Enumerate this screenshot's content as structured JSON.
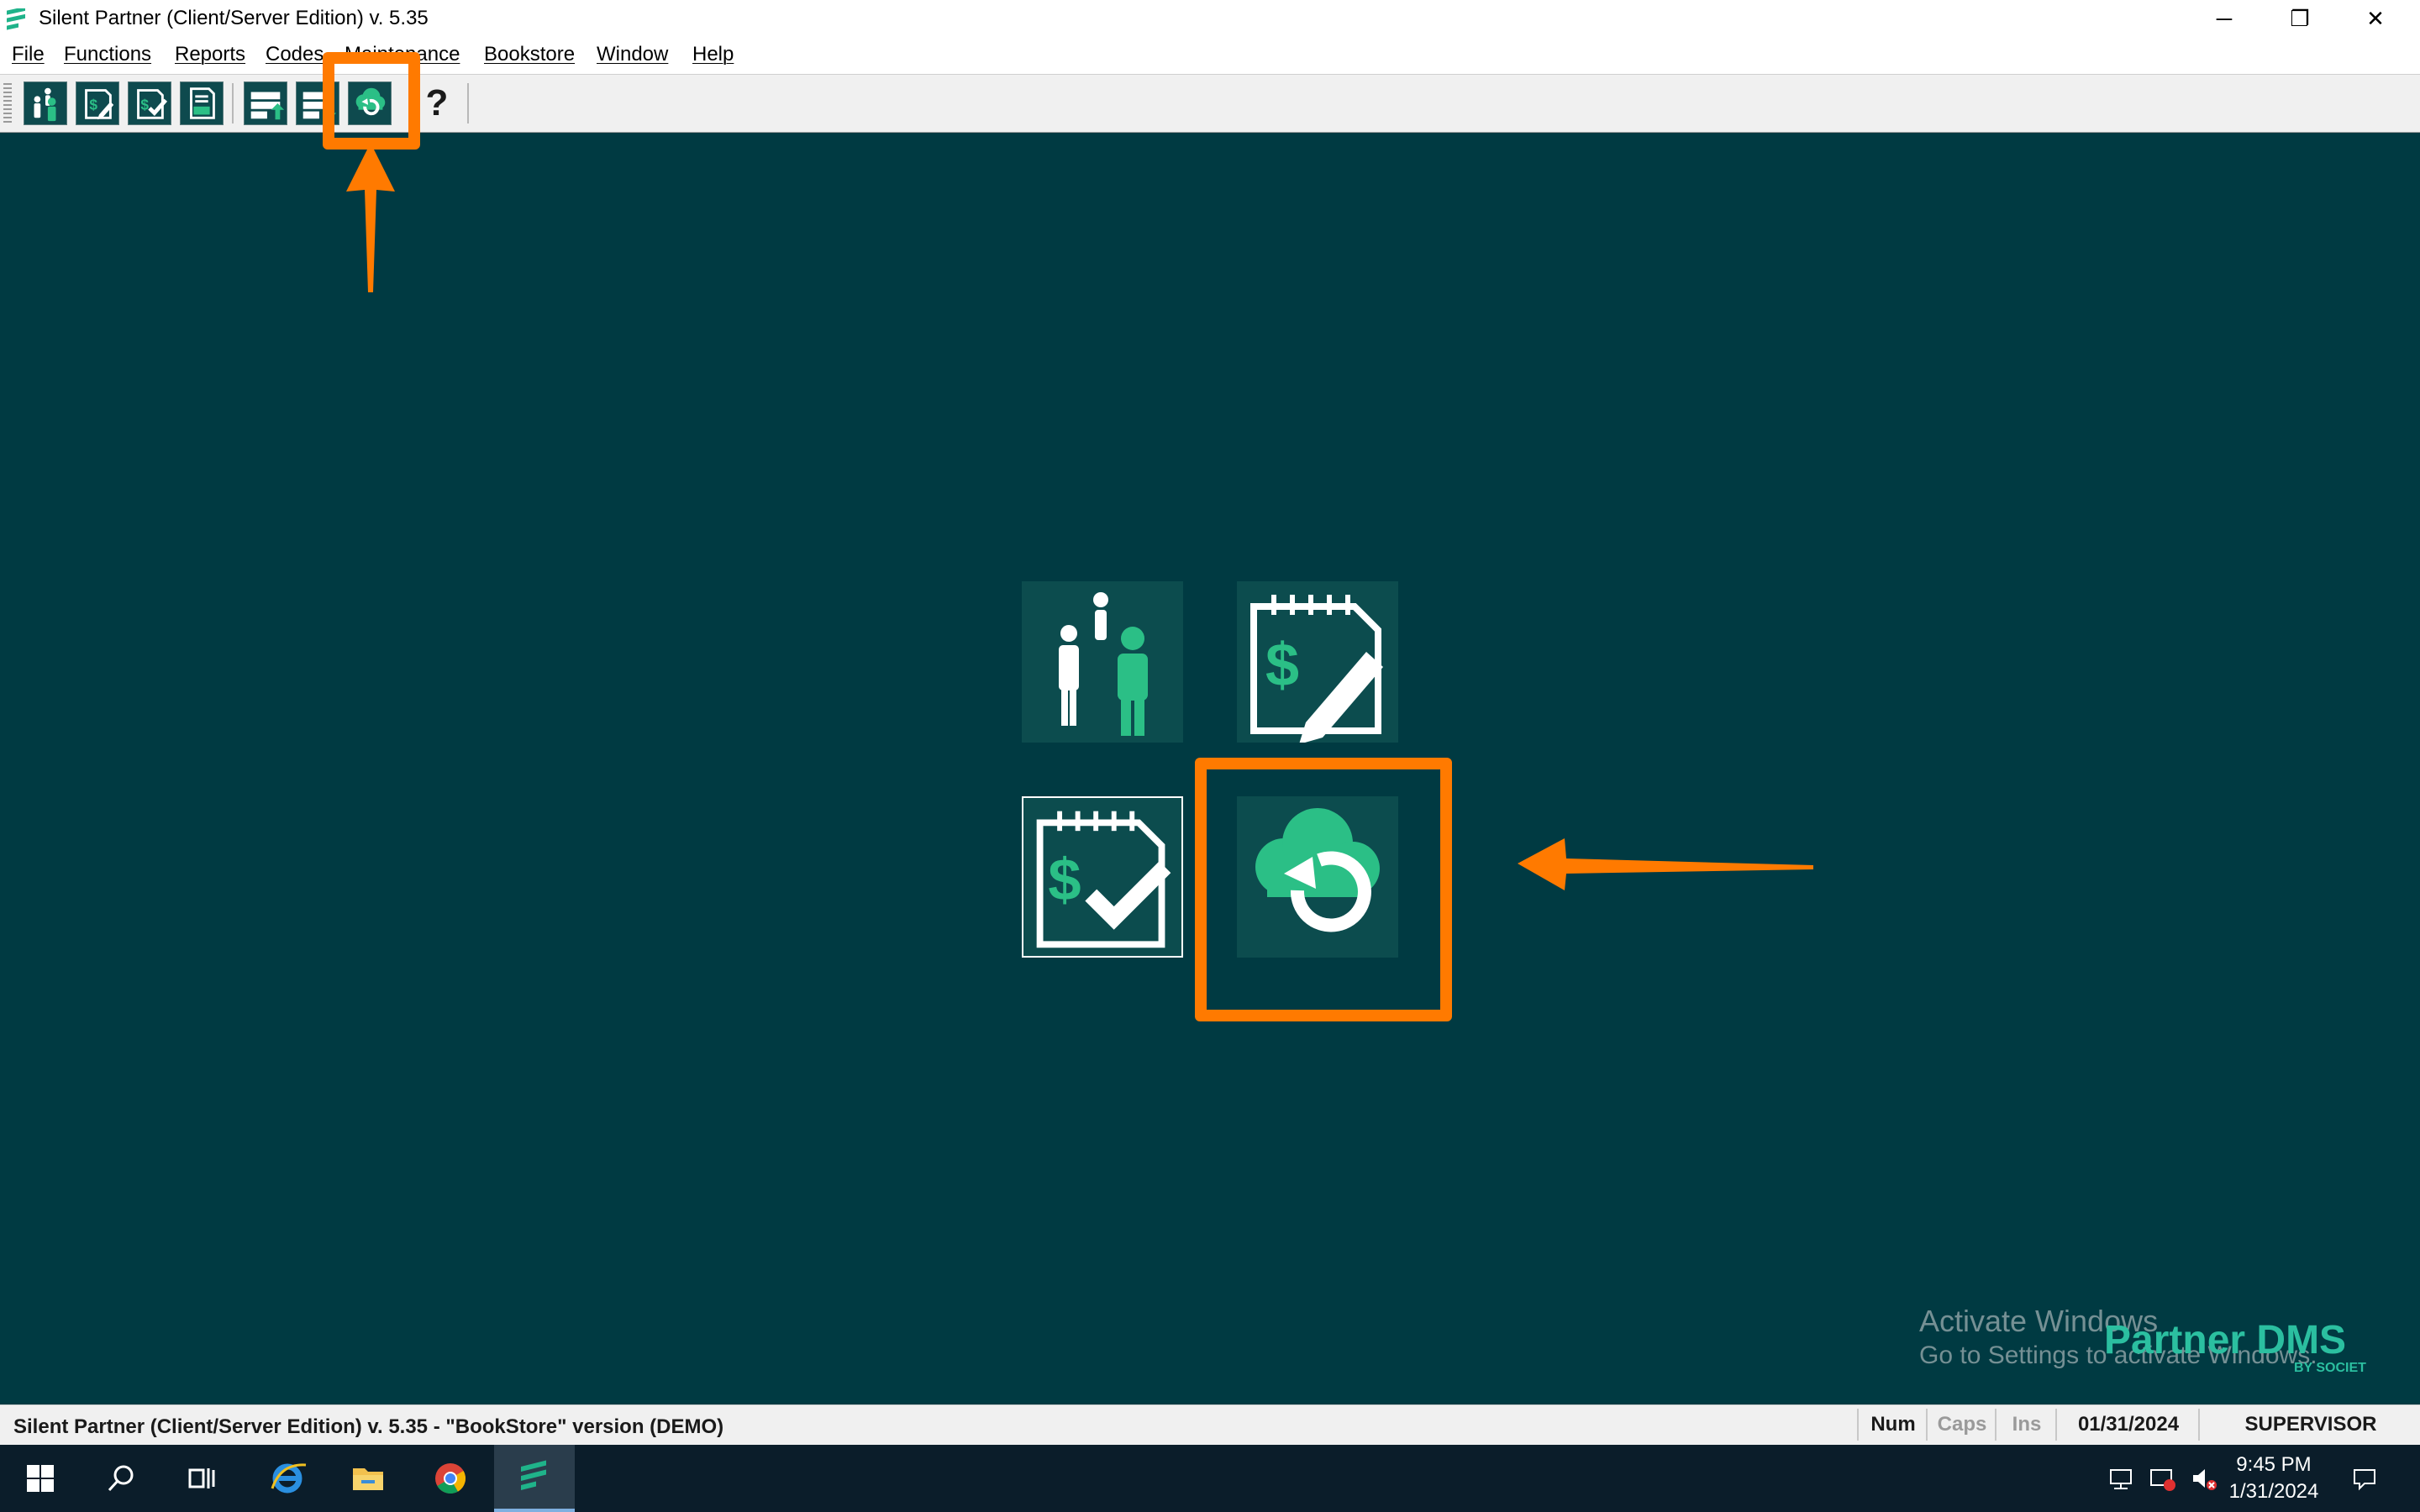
{
  "window": {
    "title": "Silent Partner (Client/Server Edition) v. 5.35",
    "minimize_glyph": "─",
    "restore_glyph": "❐",
    "close_glyph": "✕"
  },
  "menu": {
    "items": [
      "File",
      "Functions",
      "Reports",
      "Codes",
      "Maintenance",
      "Bookstore",
      "Window",
      "Help"
    ]
  },
  "toolbar": {
    "buttons": [
      {
        "icon": "customers-icon"
      },
      {
        "icon": "invoice-edit-icon"
      },
      {
        "icon": "invoice-check-icon"
      },
      {
        "icon": "tax-document-icon"
      },
      {
        "icon": "server-upload-icon"
      },
      {
        "icon": "server-download-icon"
      },
      {
        "icon": "cloud-sync-icon"
      },
      {
        "icon": "help-icon"
      }
    ],
    "help_glyph": "?"
  },
  "tiles": [
    {
      "icon": "customers-icon"
    },
    {
      "icon": "invoice-edit-icon"
    },
    {
      "icon": "invoice-check-icon"
    },
    {
      "icon": "cloud-sync-icon"
    }
  ],
  "watermark": {
    "line1": "Activate Windows",
    "line2": "Go to Settings to activate Windows."
  },
  "brand": {
    "name": "Partner DMS",
    "sub": "BY SOCIET"
  },
  "statusbar": {
    "text": "Silent Partner (Client/Server Edition) v. 5.35 - \"BookStore\" version (DEMO)",
    "num": "Num",
    "caps": "Caps",
    "ins": "Ins",
    "date": "01/31/2024",
    "user": "SUPERVISOR"
  },
  "taskbar": {
    "time": "9:45 PM",
    "date": "1/31/2024"
  },
  "colors": {
    "background": "#003a42",
    "accent_annotation": "#ff7a00",
    "brand": "#2bbfa0"
  }
}
